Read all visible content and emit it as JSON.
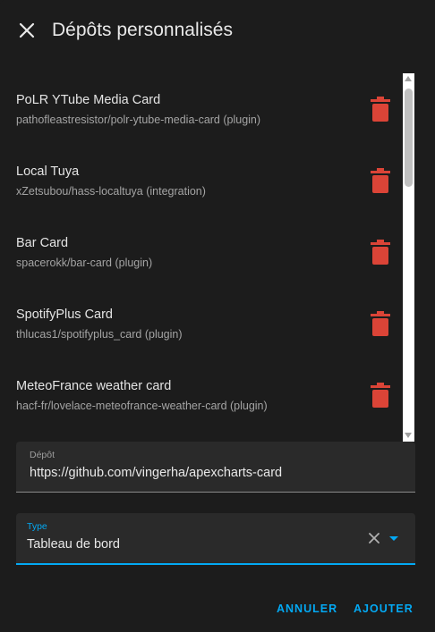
{
  "dialog": {
    "title": "Dépôts personnalisés"
  },
  "repositories": [
    {
      "name": "PoLR YTube Media Card",
      "path": "pathofleastresistor/polr-ytube-media-card (plugin)"
    },
    {
      "name": "Local Tuya",
      "path": "xZetsubou/hass-localtuya (integration)"
    },
    {
      "name": "Bar Card",
      "path": "spacerokk/bar-card (plugin)"
    },
    {
      "name": "SpotifyPlus Card",
      "path": "thlucas1/spotifyplus_card (plugin)"
    },
    {
      "name": "MeteoFrance weather card",
      "path": "hacf-fr/lovelace-meteofrance-weather-card (plugin)"
    }
  ],
  "form": {
    "repository_label": "Dépôt",
    "repository_value": "https://github.com/vingerha/apexcharts-card",
    "type_label": "Type",
    "type_value": "Tableau de bord"
  },
  "actions": {
    "cancel_label": "ANNULER",
    "add_label": "AJOUTER"
  },
  "colors": {
    "accent": "#03a9f4",
    "delete": "#db4437",
    "background": "#1c1c1c"
  },
  "icons": {
    "close": "close-icon",
    "delete": "trash-icon",
    "clear": "clear-icon",
    "dropdown": "dropdown-arrow-icon"
  }
}
